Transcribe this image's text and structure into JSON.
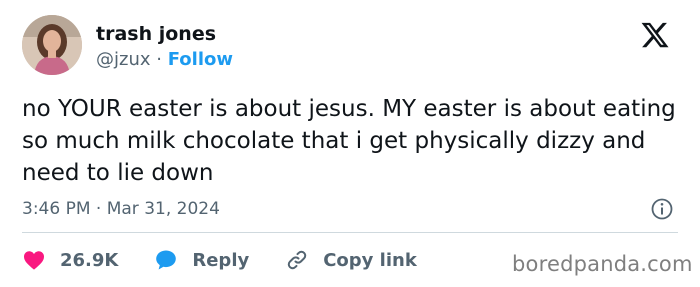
{
  "author": {
    "display_name": "trash jones",
    "handle": "@jzux",
    "separator": "·",
    "follow_label": "Follow"
  },
  "tweet": {
    "text": "no YOUR easter is about jesus. MY easter is about eating so much milk chocolate that i get physically dizzy and need to lie down",
    "time": "3:46 PM",
    "separator": "·",
    "date": "Mar 31, 2024"
  },
  "actions": {
    "likes": "26.9K",
    "reply_label": "Reply",
    "copy_link_label": "Copy link"
  },
  "watermark": "boredpanda.com",
  "icons": {
    "logo": "x-logo-icon",
    "info": "info-icon",
    "like": "heart-icon",
    "reply": "speech-bubble-icon",
    "copy": "link-icon"
  },
  "colors": {
    "text": "#0f1419",
    "muted": "#536471",
    "accent": "#1d9bf0",
    "like": "#f91880"
  }
}
